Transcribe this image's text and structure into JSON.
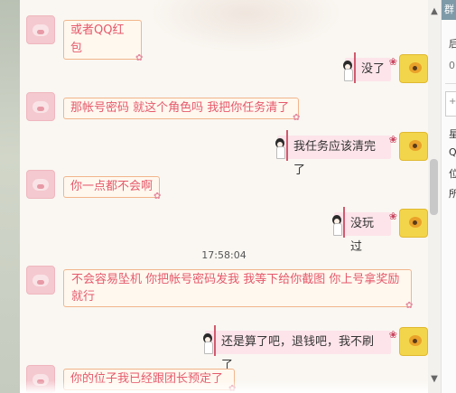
{
  "chat": {
    "messages": [
      {
        "side": "left",
        "text": "或者QQ红包"
      },
      {
        "side": "right",
        "text": "没了"
      },
      {
        "side": "left",
        "text": "那帐号密码 就这个角色吗 我把你任务清了"
      },
      {
        "side": "right",
        "text": "我任务应该清完了"
      },
      {
        "side": "left",
        "text": "你一点都不会啊"
      },
      {
        "side": "right",
        "text": "没玩过"
      },
      {
        "side": "left",
        "text": "不会容易坠机  你把帐号密码发我 我等下给你截图 你上号拿奖励就行"
      },
      {
        "side": "right",
        "text": "还是算了吧，退钱吧，我不刷了"
      },
      {
        "side": "left",
        "text": "你的位子我已经跟团长预定了"
      }
    ],
    "timestamp": "17:58:04"
  },
  "right_panel": {
    "tab_label": "群",
    "line1": "后",
    "line2": "0",
    "button_label": "+",
    "info1": "星",
    "info2": "Q",
    "info3": "位",
    "info4": "所"
  },
  "scrollbar": {
    "up": "▲",
    "down": "▼"
  },
  "colors": {
    "left_text": "#e5596b",
    "right_bubble": "#fde4ea",
    "left_border": "#f1b58b"
  },
  "icons": {
    "left_avatar": "pig-avatar",
    "right_avatar": "duck-avatar",
    "bubble_deco": "flower-icon"
  }
}
